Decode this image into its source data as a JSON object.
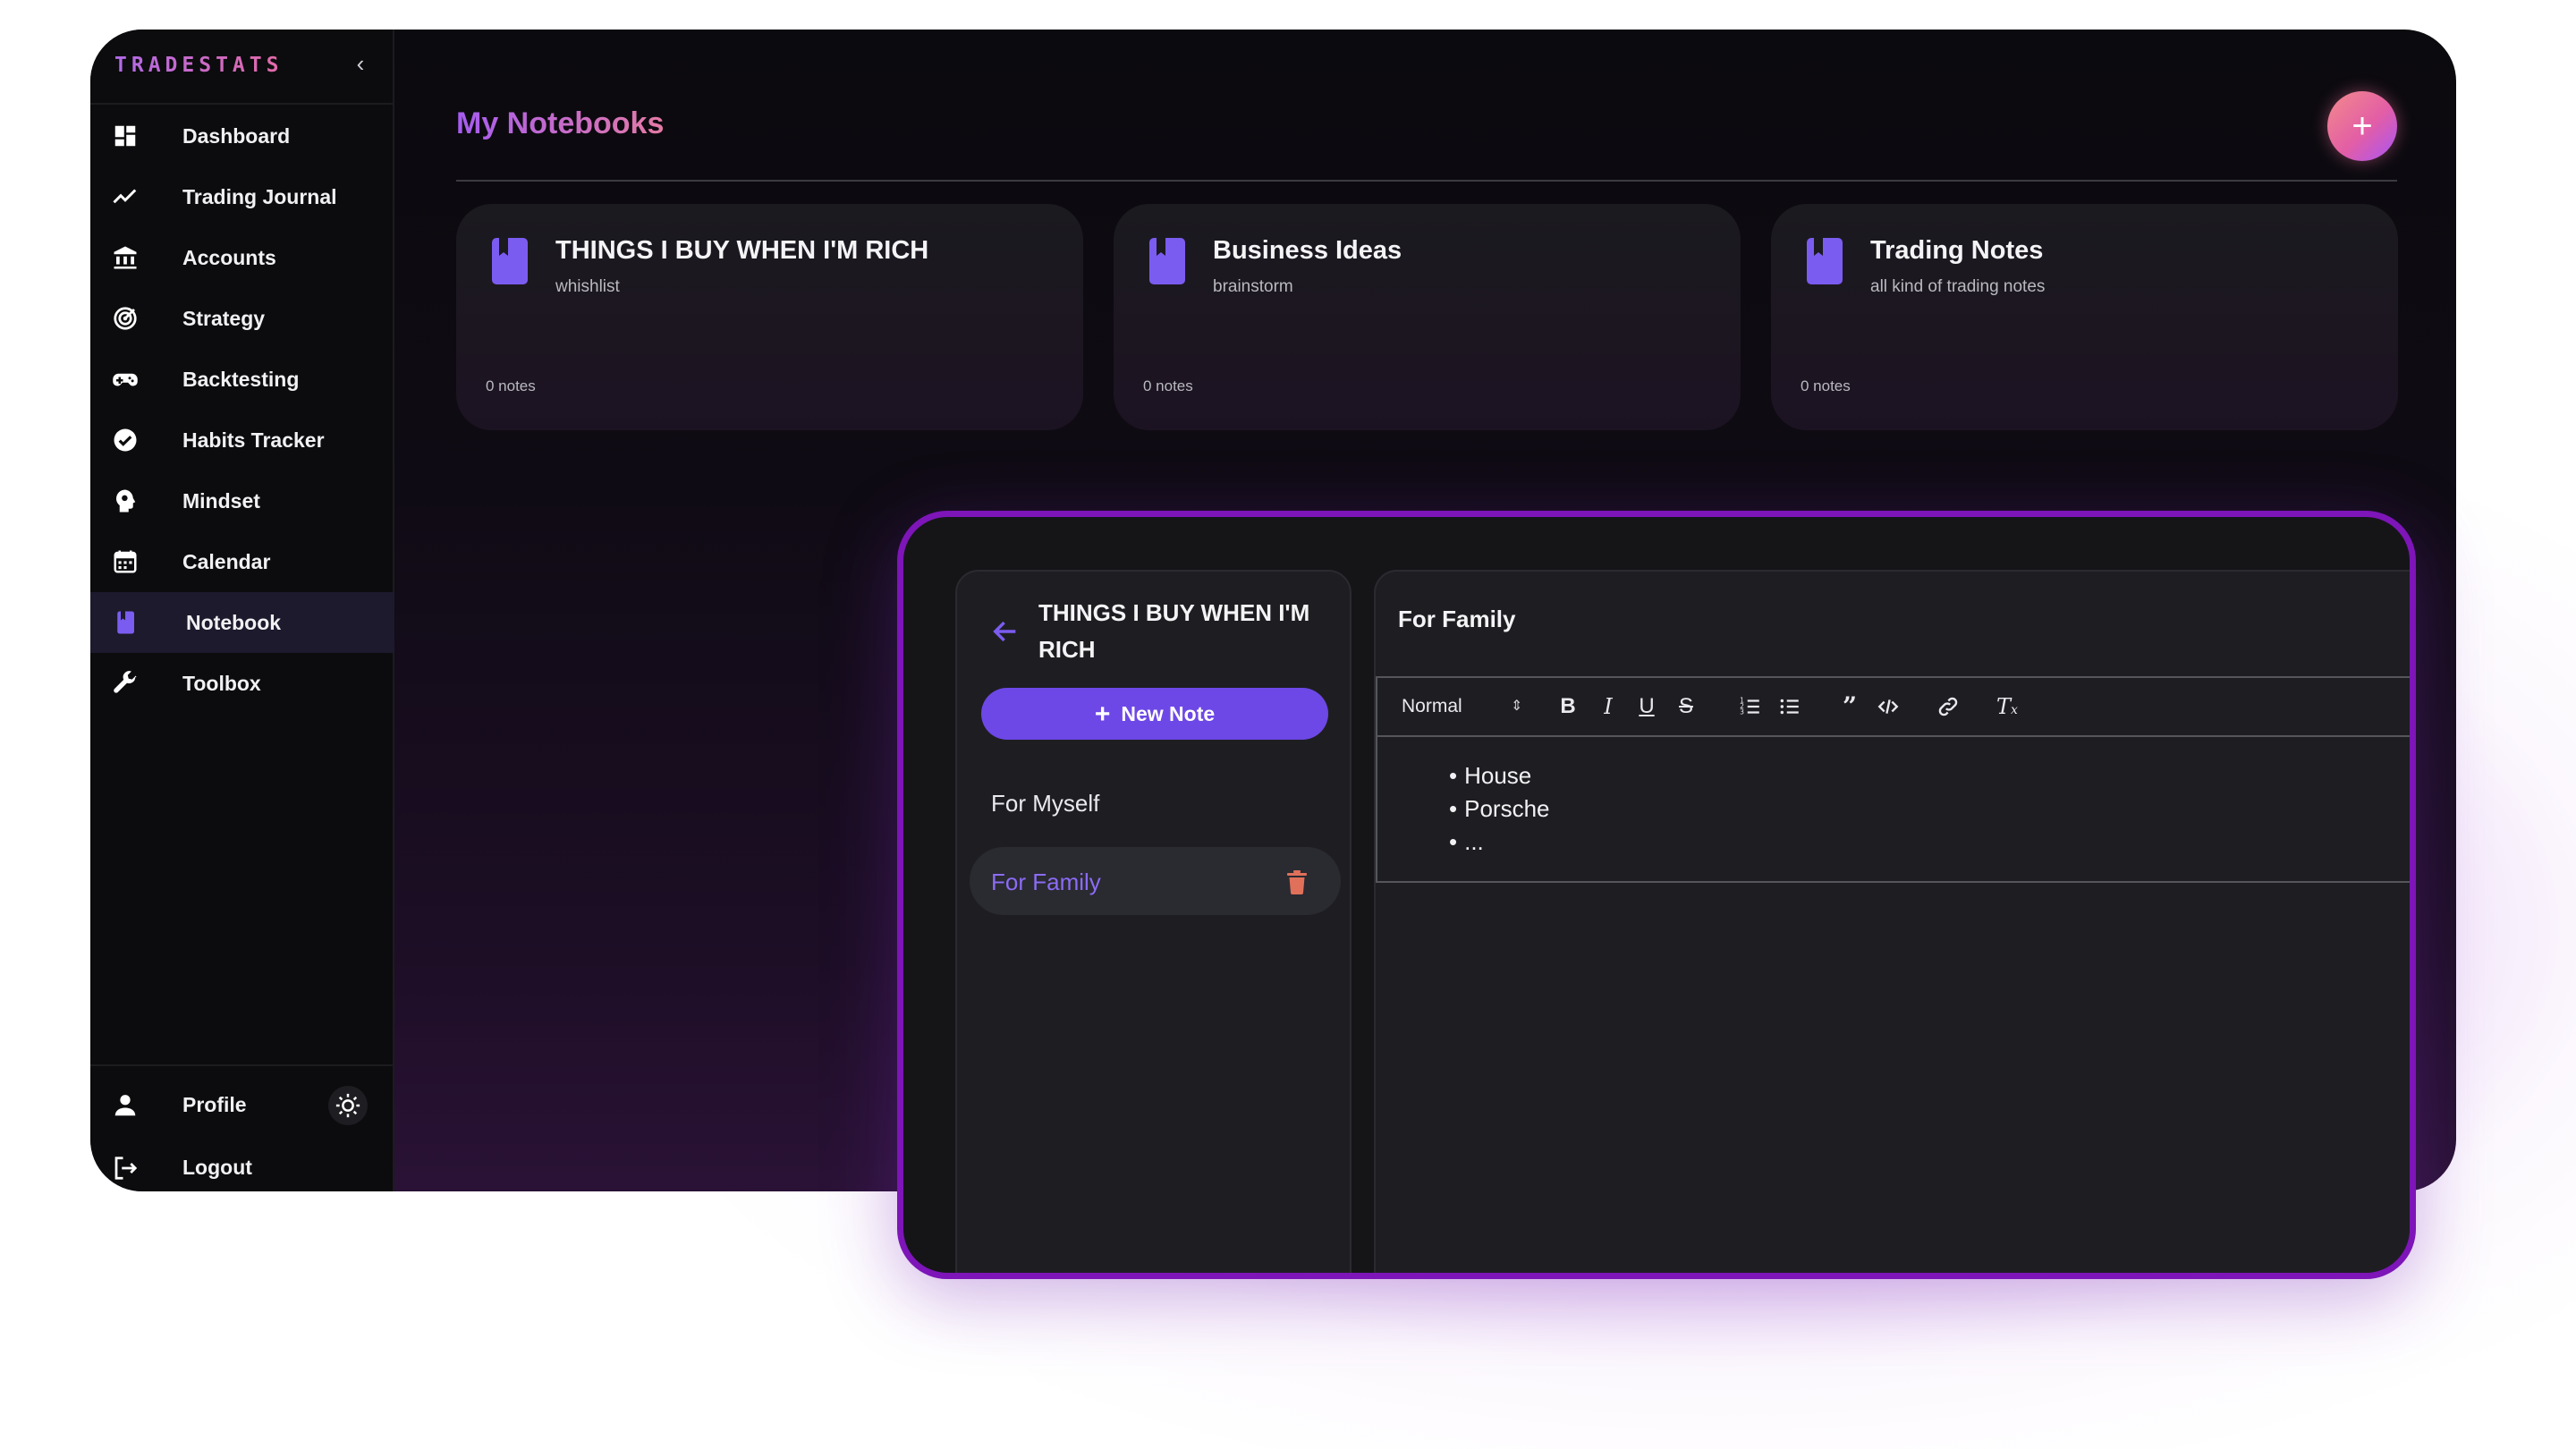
{
  "brand": "TRADESTATS",
  "sidebar": {
    "items": [
      {
        "label": "Dashboard"
      },
      {
        "label": "Trading Journal"
      },
      {
        "label": "Accounts"
      },
      {
        "label": "Strategy"
      },
      {
        "label": "Backtesting"
      },
      {
        "label": "Habits Tracker"
      },
      {
        "label": "Mindset"
      },
      {
        "label": "Calendar"
      },
      {
        "label": "Notebook",
        "active": true
      },
      {
        "label": "Toolbox"
      }
    ],
    "profile": "Profile",
    "logout": "Logout"
  },
  "main": {
    "title": "My Notebooks",
    "add_button": "+",
    "notebooks": [
      {
        "title": "THINGS I BUY WHEN I'M RICH",
        "description": "whishlist",
        "count": "0 notes"
      },
      {
        "title": "Business Ideas",
        "description": "brainstorm",
        "count": "0 notes"
      },
      {
        "title": "Trading Notes",
        "description": "all kind of trading notes",
        "count": "0 notes"
      }
    ]
  },
  "editor_panel": {
    "notebook_name": "THINGS I BUY WHEN I'M RICH",
    "new_note": "New Note",
    "notes": [
      "For Myself",
      "For Family"
    ],
    "active_note": "For Family",
    "note_title": "For Family",
    "toolbar": {
      "format": "Normal"
    },
    "content": [
      "House",
      "Porsche",
      "..."
    ]
  },
  "colors": {
    "accent": "#6d48e6",
    "active_note_text": "#8b6cf5",
    "panel_border": "#7d15b8",
    "trash": "#e0705a"
  }
}
